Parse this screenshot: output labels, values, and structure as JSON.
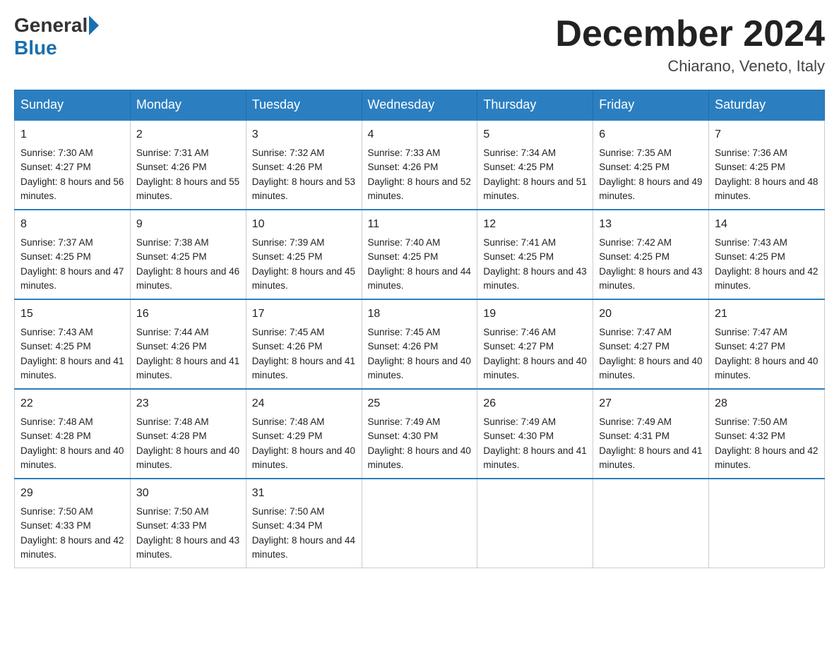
{
  "header": {
    "logo_general": "General",
    "logo_blue": "Blue",
    "title": "December 2024",
    "subtitle": "Chiarano, Veneto, Italy"
  },
  "days": [
    "Sunday",
    "Monday",
    "Tuesday",
    "Wednesday",
    "Thursday",
    "Friday",
    "Saturday"
  ],
  "weeks": [
    [
      {
        "day": "1",
        "sunrise": "7:30 AM",
        "sunset": "4:27 PM",
        "daylight": "8 hours and 56 minutes."
      },
      {
        "day": "2",
        "sunrise": "7:31 AM",
        "sunset": "4:26 PM",
        "daylight": "8 hours and 55 minutes."
      },
      {
        "day": "3",
        "sunrise": "7:32 AM",
        "sunset": "4:26 PM",
        "daylight": "8 hours and 53 minutes."
      },
      {
        "day": "4",
        "sunrise": "7:33 AM",
        "sunset": "4:26 PM",
        "daylight": "8 hours and 52 minutes."
      },
      {
        "day": "5",
        "sunrise": "7:34 AM",
        "sunset": "4:25 PM",
        "daylight": "8 hours and 51 minutes."
      },
      {
        "day": "6",
        "sunrise": "7:35 AM",
        "sunset": "4:25 PM",
        "daylight": "8 hours and 49 minutes."
      },
      {
        "day": "7",
        "sunrise": "7:36 AM",
        "sunset": "4:25 PM",
        "daylight": "8 hours and 48 minutes."
      }
    ],
    [
      {
        "day": "8",
        "sunrise": "7:37 AM",
        "sunset": "4:25 PM",
        "daylight": "8 hours and 47 minutes."
      },
      {
        "day": "9",
        "sunrise": "7:38 AM",
        "sunset": "4:25 PM",
        "daylight": "8 hours and 46 minutes."
      },
      {
        "day": "10",
        "sunrise": "7:39 AM",
        "sunset": "4:25 PM",
        "daylight": "8 hours and 45 minutes."
      },
      {
        "day": "11",
        "sunrise": "7:40 AM",
        "sunset": "4:25 PM",
        "daylight": "8 hours and 44 minutes."
      },
      {
        "day": "12",
        "sunrise": "7:41 AM",
        "sunset": "4:25 PM",
        "daylight": "8 hours and 43 minutes."
      },
      {
        "day": "13",
        "sunrise": "7:42 AM",
        "sunset": "4:25 PM",
        "daylight": "8 hours and 43 minutes."
      },
      {
        "day": "14",
        "sunrise": "7:43 AM",
        "sunset": "4:25 PM",
        "daylight": "8 hours and 42 minutes."
      }
    ],
    [
      {
        "day": "15",
        "sunrise": "7:43 AM",
        "sunset": "4:25 PM",
        "daylight": "8 hours and 41 minutes."
      },
      {
        "day": "16",
        "sunrise": "7:44 AM",
        "sunset": "4:26 PM",
        "daylight": "8 hours and 41 minutes."
      },
      {
        "day": "17",
        "sunrise": "7:45 AM",
        "sunset": "4:26 PM",
        "daylight": "8 hours and 41 minutes."
      },
      {
        "day": "18",
        "sunrise": "7:45 AM",
        "sunset": "4:26 PM",
        "daylight": "8 hours and 40 minutes."
      },
      {
        "day": "19",
        "sunrise": "7:46 AM",
        "sunset": "4:27 PM",
        "daylight": "8 hours and 40 minutes."
      },
      {
        "day": "20",
        "sunrise": "7:47 AM",
        "sunset": "4:27 PM",
        "daylight": "8 hours and 40 minutes."
      },
      {
        "day": "21",
        "sunrise": "7:47 AM",
        "sunset": "4:27 PM",
        "daylight": "8 hours and 40 minutes."
      }
    ],
    [
      {
        "day": "22",
        "sunrise": "7:48 AM",
        "sunset": "4:28 PM",
        "daylight": "8 hours and 40 minutes."
      },
      {
        "day": "23",
        "sunrise": "7:48 AM",
        "sunset": "4:28 PM",
        "daylight": "8 hours and 40 minutes."
      },
      {
        "day": "24",
        "sunrise": "7:48 AM",
        "sunset": "4:29 PM",
        "daylight": "8 hours and 40 minutes."
      },
      {
        "day": "25",
        "sunrise": "7:49 AM",
        "sunset": "4:30 PM",
        "daylight": "8 hours and 40 minutes."
      },
      {
        "day": "26",
        "sunrise": "7:49 AM",
        "sunset": "4:30 PM",
        "daylight": "8 hours and 41 minutes."
      },
      {
        "day": "27",
        "sunrise": "7:49 AM",
        "sunset": "4:31 PM",
        "daylight": "8 hours and 41 minutes."
      },
      {
        "day": "28",
        "sunrise": "7:50 AM",
        "sunset": "4:32 PM",
        "daylight": "8 hours and 42 minutes."
      }
    ],
    [
      {
        "day": "29",
        "sunrise": "7:50 AM",
        "sunset": "4:33 PM",
        "daylight": "8 hours and 42 minutes."
      },
      {
        "day": "30",
        "sunrise": "7:50 AM",
        "sunset": "4:33 PM",
        "daylight": "8 hours and 43 minutes."
      },
      {
        "day": "31",
        "sunrise": "7:50 AM",
        "sunset": "4:34 PM",
        "daylight": "8 hours and 44 minutes."
      },
      null,
      null,
      null,
      null
    ]
  ]
}
